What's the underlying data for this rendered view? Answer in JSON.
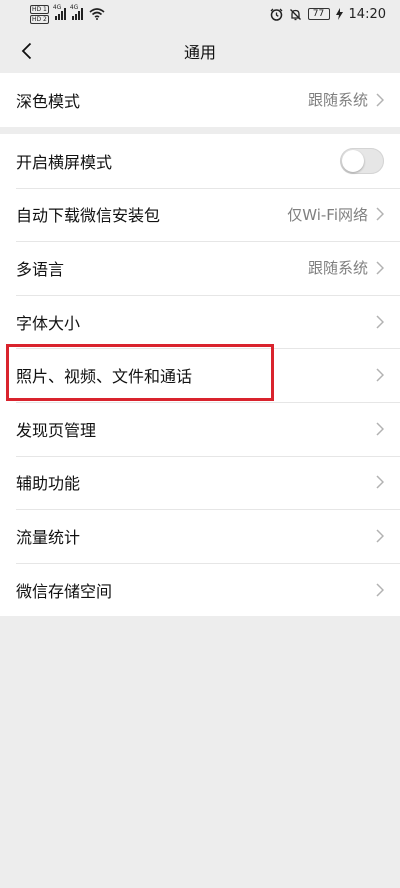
{
  "status_bar": {
    "hd1": "HD 1",
    "hd2": "HD 2",
    "net1": "4G",
    "net2": "4G",
    "battery": "77",
    "time": "14:20"
  },
  "header": {
    "title": "通用"
  },
  "groups": [
    {
      "items": [
        {
          "label": "深色模式",
          "value": "跟随系统"
        }
      ]
    },
    {
      "items": [
        {
          "label": "开启横屏模式",
          "toggle": false
        },
        {
          "label": "自动下载微信安装包",
          "value": "仅Wi-Fi网络"
        },
        {
          "label": "多语言",
          "value": "跟随系统"
        },
        {
          "label": "字体大小",
          "value": ""
        },
        {
          "label": "照片、视频、文件和通话",
          "value": "",
          "highlighted": true
        },
        {
          "label": "发现页管理",
          "value": ""
        },
        {
          "label": "辅助功能",
          "value": ""
        },
        {
          "label": "流量统计",
          "value": ""
        },
        {
          "label": "微信存储空间",
          "value": ""
        }
      ]
    }
  ],
  "colors": {
    "background": "#ededed",
    "highlight": "#d9232d",
    "secondary_text": "#808080"
  }
}
